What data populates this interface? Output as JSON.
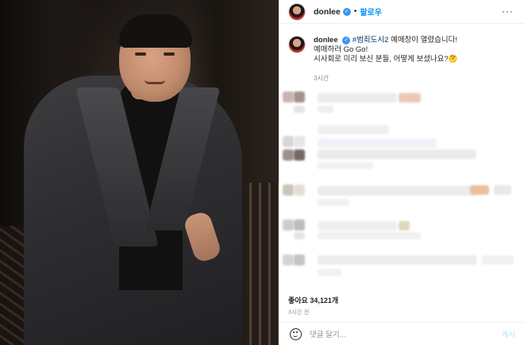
{
  "header": {
    "username": "donlee",
    "separator": "•",
    "follow_label": "팔로우",
    "more_label": "···"
  },
  "caption": {
    "username": "donlee",
    "hashtag": "#범죄도시2",
    "line1_rest": " 예매창이 열렸습니다!",
    "line2": "예매하러 Go Go!",
    "line3": "시사회로 미리 보신 분들, 어떻게 보셨나요?🤔",
    "time": "3시간"
  },
  "footer": {
    "likes": "좋아요 34,121개",
    "time_ago": "3시간 전",
    "comment_placeholder": "댓글 달기...",
    "post_label": "게시"
  },
  "icons": {
    "verified": "verified-badge-icon",
    "emoji": "smile-icon",
    "more": "more-options-icon"
  },
  "colors": {
    "link_blue": "#0095f6",
    "verified_blue": "#3897f0",
    "hashtag": "#00376b",
    "muted": "#8e8e8e",
    "post_disabled": "#b2dffc"
  }
}
